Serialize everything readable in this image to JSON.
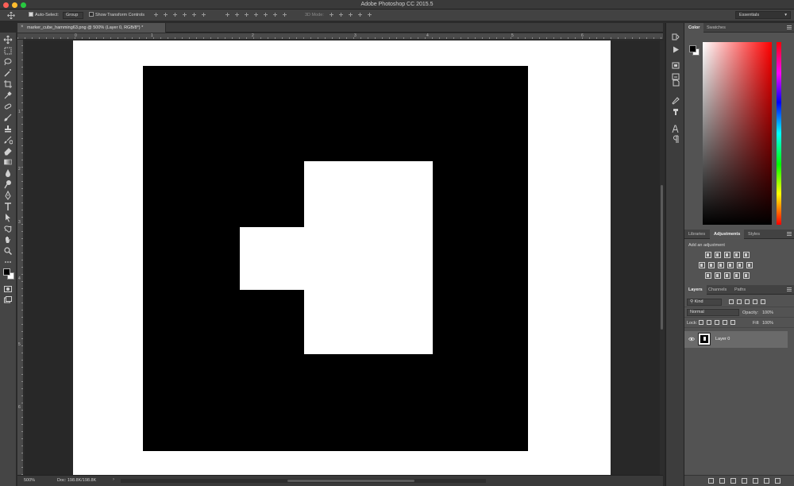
{
  "window": {
    "title": "Adobe Photoshop CC 2015.5"
  },
  "options_bar": {
    "auto_select_label": "Auto-Select:",
    "auto_select_value": "Group",
    "show_transform_label": "Show Transform Controls",
    "mode_3d_label": "3D Mode:",
    "workspace": "Essentials"
  },
  "document": {
    "tab_title": "marker_cube_hamming63.png @ 500% (Layer 0, RGB/8*) *",
    "zoom": "500%",
    "doc_size": "Doc: 198.8K/198.8K"
  },
  "rulers": {
    "top": [
      "0",
      "1",
      "2",
      "3",
      "4",
      "5",
      "6"
    ],
    "left": [
      "1",
      "2",
      "3",
      "4",
      "5",
      "6"
    ]
  },
  "panels": {
    "color_tabs": [
      "Color",
      "Swatches"
    ],
    "adjust_tabs": [
      "Libraries",
      "Adjustments",
      "Styles"
    ],
    "adjust_hint": "Add an adjustment",
    "layer_tabs": [
      "Layers",
      "Channels",
      "Paths"
    ]
  },
  "layers": {
    "filter_kind": "Kind",
    "blend_mode": "Normal",
    "opacity_label": "Opacity:",
    "opacity_value": "100%",
    "lock_label": "Lock:",
    "fill_label": "Fill:",
    "fill_value": "100%",
    "items": [
      {
        "name": "Layer 0",
        "visible": true
      }
    ]
  },
  "colors": {
    "foreground": "#000000",
    "background": "#ffffff",
    "marker_black": "#000000",
    "marker_white": "#ffffff"
  }
}
